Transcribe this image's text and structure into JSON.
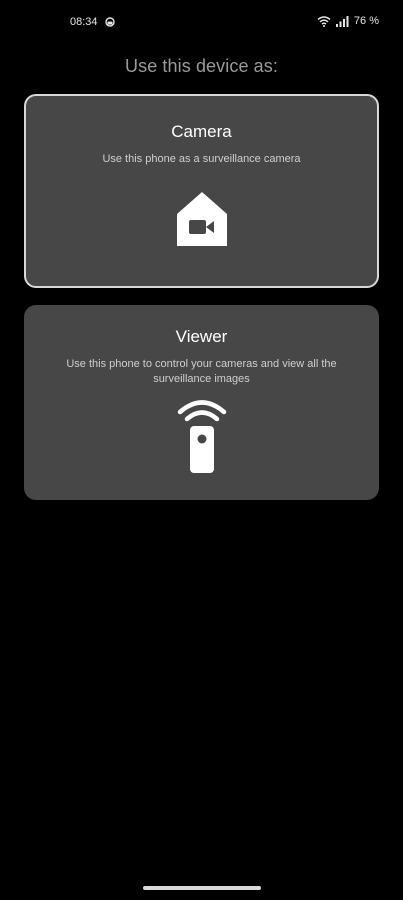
{
  "status_bar": {
    "time": "08:34",
    "battery": "76 %",
    "icons": [
      "notification-icon",
      "wifi-icon",
      "signal-icon"
    ]
  },
  "heading": "Use this device as:",
  "cards": [
    {
      "title": "Camera",
      "description": "Use this phone as a surveillance camera",
      "icon": "house-camera-icon",
      "selected": true
    },
    {
      "title": "Viewer",
      "description": "Use this phone to control your cameras and view all the surveillance images",
      "icon": "remote-control-icon",
      "selected": false
    }
  ],
  "colors": {
    "background": "#000000",
    "card": "#474747",
    "selected_border": "#d8d8d8",
    "heading": "#9a9a9a"
  }
}
